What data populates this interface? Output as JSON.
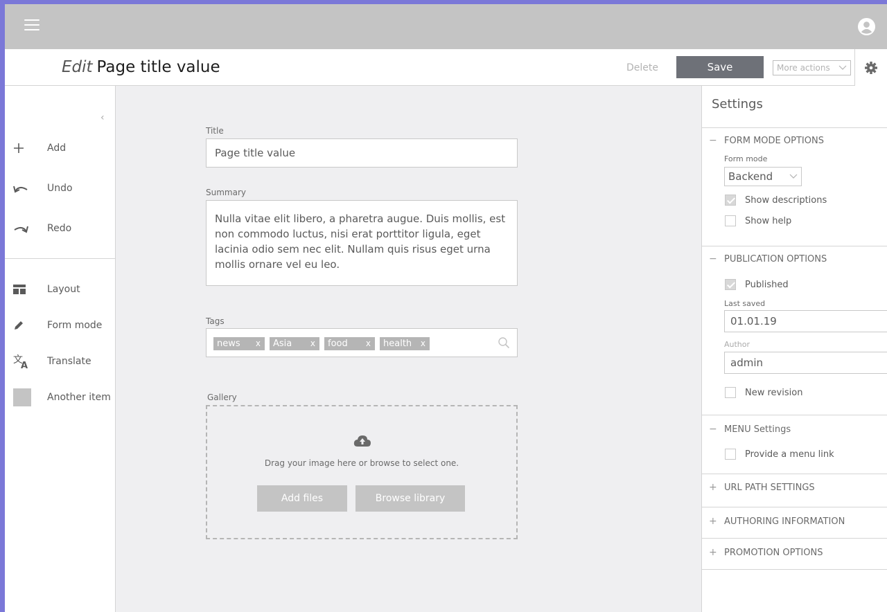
{
  "topbar": {
    "menu_icon": "hamburger-icon",
    "user_icon": "user-circle-icon"
  },
  "header": {
    "edit_label": "Edit",
    "page_title": "Page title value",
    "delete_label": "Delete",
    "save_label": "Save",
    "more_actions_label": "More actions",
    "settings_icon": "gear-icon"
  },
  "sidebar": {
    "items": [
      {
        "label": "Add",
        "icon": "plus-icon"
      },
      {
        "label": "Undo",
        "icon": "undo-icon"
      },
      {
        "label": "Redo",
        "icon": "redo-icon"
      },
      {
        "label": "Layout",
        "icon": "layout-icon"
      },
      {
        "label": "Form mode",
        "icon": "pencil-icon"
      },
      {
        "label": "Translate",
        "icon": "translate-icon"
      },
      {
        "label": "Another item",
        "icon": "square-icon"
      }
    ]
  },
  "form": {
    "title_label": "Title",
    "title_value": "Page title value",
    "summary_label": "Summary",
    "summary_value": "Nulla vitae elit libero, a pharetra augue. Duis mollis, est non commodo luctus, nisi erat porttitor ligula, eget lacinia odio sem nec elit. Nullam quis risus eget urna mollis ornare vel eu leo.",
    "tags_label": "Tags",
    "tags": [
      "news",
      "Asia",
      "food",
      "health"
    ],
    "tag_remove": "x",
    "gallery_label": "Gallery",
    "gallery_text": "Drag your image here or browse to select one.",
    "add_files_label": "Add files",
    "browse_library_label": "Browse library"
  },
  "settings": {
    "title": "Settings",
    "form_mode_section": "FORM MODE OPTIONS",
    "form_mode_label": "Form mode",
    "form_mode_value": "Backend",
    "show_descriptions": "Show descriptions",
    "show_help": "Show help",
    "publication_section": "PUBLICATION OPTIONS",
    "published": "Published",
    "last_saved_label": "Last saved",
    "last_saved_value": "01.01.19",
    "author_label": "Author",
    "author_value": "admin",
    "new_revision": "New revision",
    "menu_section": "MENU Settings",
    "menu_link": "Provide a menu link",
    "url_section": "URL PATH SETTINGS",
    "authoring_section": "AUTHORING INFORMATION",
    "promotion_section": "PROMOTION OPTIONS",
    "collapse_sign": "−",
    "expand_sign": "+"
  }
}
